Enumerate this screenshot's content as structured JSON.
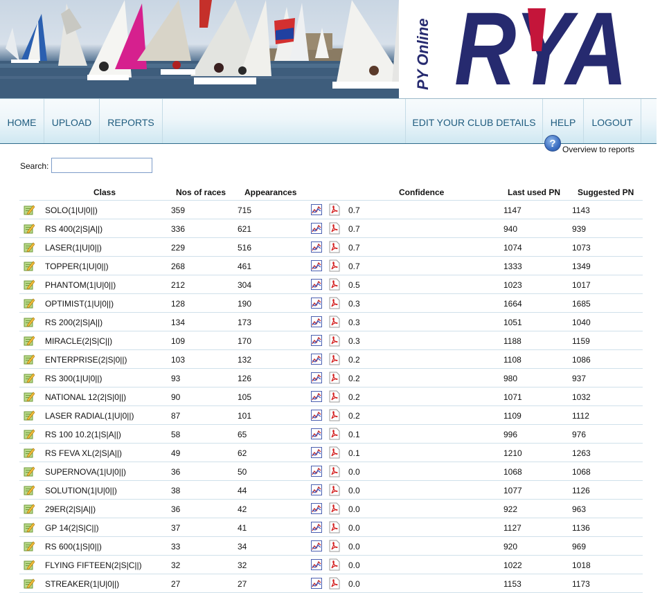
{
  "header": {
    "tagline": "PY Online",
    "logo_text": "RYA",
    "colors": {
      "navy": "#262a6f",
      "red": "#c4153a"
    }
  },
  "nav": {
    "home": "HOME",
    "upload": "UPLOAD",
    "reports": "REPORTS",
    "edit_club": "EDIT YOUR CLUB DETAILS",
    "help": "HELP",
    "logout": "LOGOUT"
  },
  "help_link": {
    "icon": "question-icon",
    "glyph": "?",
    "label": "Overview to reports"
  },
  "search": {
    "label": "Search:",
    "value": "",
    "placeholder": ""
  },
  "table": {
    "columns": {
      "class": "Class",
      "races": "Nos of races",
      "appearances": "Appearances",
      "confidence": "Confidence",
      "last_pn": "Last used PN",
      "suggested_pn": "Suggested PN"
    },
    "rows": [
      {
        "class": "SOLO(1|U|0||)",
        "races": "359",
        "appearances": "715",
        "confidence": "0.7",
        "last_pn": "1147",
        "suggested_pn": "1143"
      },
      {
        "class": "RS 400(2|S|A||)",
        "races": "336",
        "appearances": "621",
        "confidence": "0.7",
        "last_pn": "940",
        "suggested_pn": "939"
      },
      {
        "class": "LASER(1|U|0||)",
        "races": "229",
        "appearances": "516",
        "confidence": "0.7",
        "last_pn": "1074",
        "suggested_pn": "1073"
      },
      {
        "class": "TOPPER(1|U|0||)",
        "races": "268",
        "appearances": "461",
        "confidence": "0.7",
        "last_pn": "1333",
        "suggested_pn": "1349"
      },
      {
        "class": "PHANTOM(1|U|0||)",
        "races": "212",
        "appearances": "304",
        "confidence": "0.5",
        "last_pn": "1023",
        "suggested_pn": "1017"
      },
      {
        "class": "OPTIMIST(1|U|0||)",
        "races": "128",
        "appearances": "190",
        "confidence": "0.3",
        "last_pn": "1664",
        "suggested_pn": "1685"
      },
      {
        "class": "RS 200(2|S|A||)",
        "races": "134",
        "appearances": "173",
        "confidence": "0.3",
        "last_pn": "1051",
        "suggested_pn": "1040"
      },
      {
        "class": "MIRACLE(2|S|C||)",
        "races": "109",
        "appearances": "170",
        "confidence": "0.3",
        "last_pn": "1188",
        "suggested_pn": "1159"
      },
      {
        "class": "ENTERPRISE(2|S|0||)",
        "races": "103",
        "appearances": "132",
        "confidence": "0.2",
        "last_pn": "1108",
        "suggested_pn": "1086"
      },
      {
        "class": "RS 300(1|U|0||)",
        "races": "93",
        "appearances": "126",
        "confidence": "0.2",
        "last_pn": "980",
        "suggested_pn": "937"
      },
      {
        "class": "NATIONAL 12(2|S|0||)",
        "races": "90",
        "appearances": "105",
        "confidence": "0.2",
        "last_pn": "1071",
        "suggested_pn": "1032"
      },
      {
        "class": "LASER RADIAL(1|U|0||)",
        "races": "87",
        "appearances": "101",
        "confidence": "0.2",
        "last_pn": "1109",
        "suggested_pn": "1112"
      },
      {
        "class": "RS 100 10.2(1|S|A||)",
        "races": "58",
        "appearances": "65",
        "confidence": "0.1",
        "last_pn": "996",
        "suggested_pn": "976"
      },
      {
        "class": "RS FEVA XL(2|S|A||)",
        "races": "49",
        "appearances": "62",
        "confidence": "0.1",
        "last_pn": "1210",
        "suggested_pn": "1263"
      },
      {
        "class": "SUPERNOVA(1|U|0||)",
        "races": "36",
        "appearances": "50",
        "confidence": "0.0",
        "last_pn": "1068",
        "suggested_pn": "1068"
      },
      {
        "class": "SOLUTION(1|U|0||)",
        "races": "38",
        "appearances": "44",
        "confidence": "0.0",
        "last_pn": "1077",
        "suggested_pn": "1126"
      },
      {
        "class": "29ER(2|S|A||)",
        "races": "36",
        "appearances": "42",
        "confidence": "0.0",
        "last_pn": "922",
        "suggested_pn": "963"
      },
      {
        "class": "GP 14(2|S|C||)",
        "races": "37",
        "appearances": "41",
        "confidence": "0.0",
        "last_pn": "1127",
        "suggested_pn": "1136"
      },
      {
        "class": "RS 600(1|S|0||)",
        "races": "33",
        "appearances": "34",
        "confidence": "0.0",
        "last_pn": "920",
        "suggested_pn": "969"
      },
      {
        "class": "FLYING FIFTEEN(2|S|C||)",
        "races": "32",
        "appearances": "32",
        "confidence": "0.0",
        "last_pn": "1022",
        "suggested_pn": "1018"
      },
      {
        "class": "STREAKER(1|U|0||)",
        "races": "27",
        "appearances": "27",
        "confidence": "0.0",
        "last_pn": "1153",
        "suggested_pn": "1173"
      }
    ],
    "row_icons": {
      "edit": "edit-pencil-icon",
      "chart": "chart-icon",
      "pdf": "pdf-icon"
    }
  }
}
